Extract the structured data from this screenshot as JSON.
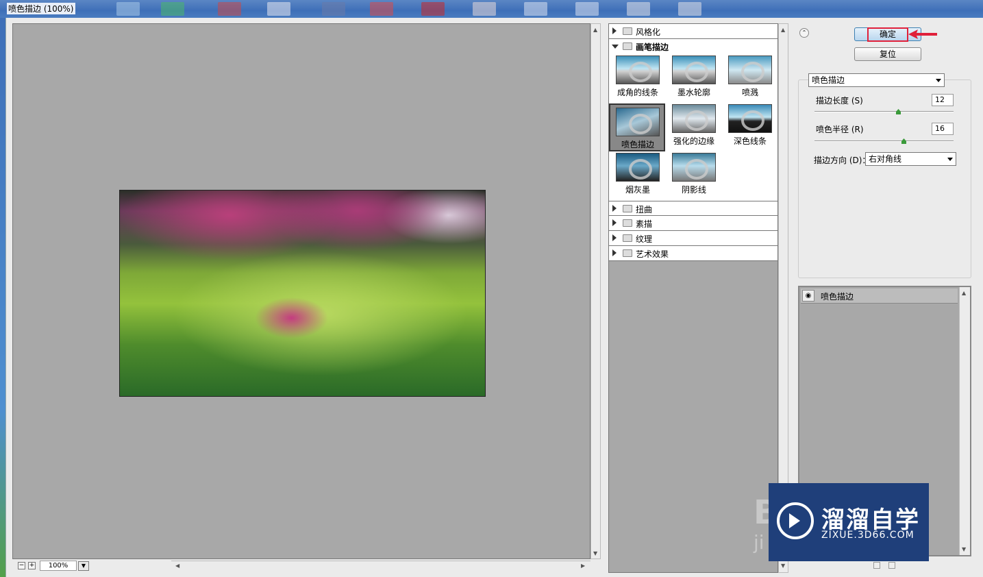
{
  "window": {
    "title": "喷色描边 (100%)"
  },
  "preview": {
    "zoom": "100%",
    "zoom_out": "−",
    "zoom_in": "+"
  },
  "filter_gallery": {
    "categories_top": [
      {
        "label": "风格化",
        "expanded": false
      },
      {
        "label": "画笔描边",
        "expanded": true
      }
    ],
    "thumbnails": [
      {
        "label": "成角的线条",
        "selected": false
      },
      {
        "label": "墨水轮廓",
        "selected": false
      },
      {
        "label": "喷溅",
        "selected": false
      },
      {
        "label": "喷色描边",
        "selected": true
      },
      {
        "label": "强化的边缘",
        "selected": false
      },
      {
        "label": "深色线条",
        "selected": false
      },
      {
        "label": "烟灰墨",
        "selected": false
      },
      {
        "label": "阴影线",
        "selected": false
      }
    ],
    "categories_bottom": [
      {
        "label": "扭曲"
      },
      {
        "label": "素描"
      },
      {
        "label": "纹理"
      },
      {
        "label": "艺术效果"
      }
    ]
  },
  "actions": {
    "ok_label": "确定",
    "reset_label": "复位"
  },
  "settings": {
    "filter_select": "喷色描边",
    "stroke_length": {
      "label": "描边长度 (S)",
      "value": "12",
      "level": 0.6
    },
    "spray_radius": {
      "label": "喷色半径 (R)",
      "value": "16",
      "level": 0.65
    },
    "stroke_direction": {
      "label": "描边方向 (D)：",
      "value": "右对角线"
    }
  },
  "layers": {
    "items": [
      {
        "name": "喷色描边",
        "visible": true
      }
    ]
  },
  "watermark": {
    "title": "溜溜自学",
    "subtitle": "ZIXUE.3D66.COM"
  },
  "colors": {
    "ok_highlight": "#e0203a",
    "watermark_bg": "#1f3f7a"
  }
}
